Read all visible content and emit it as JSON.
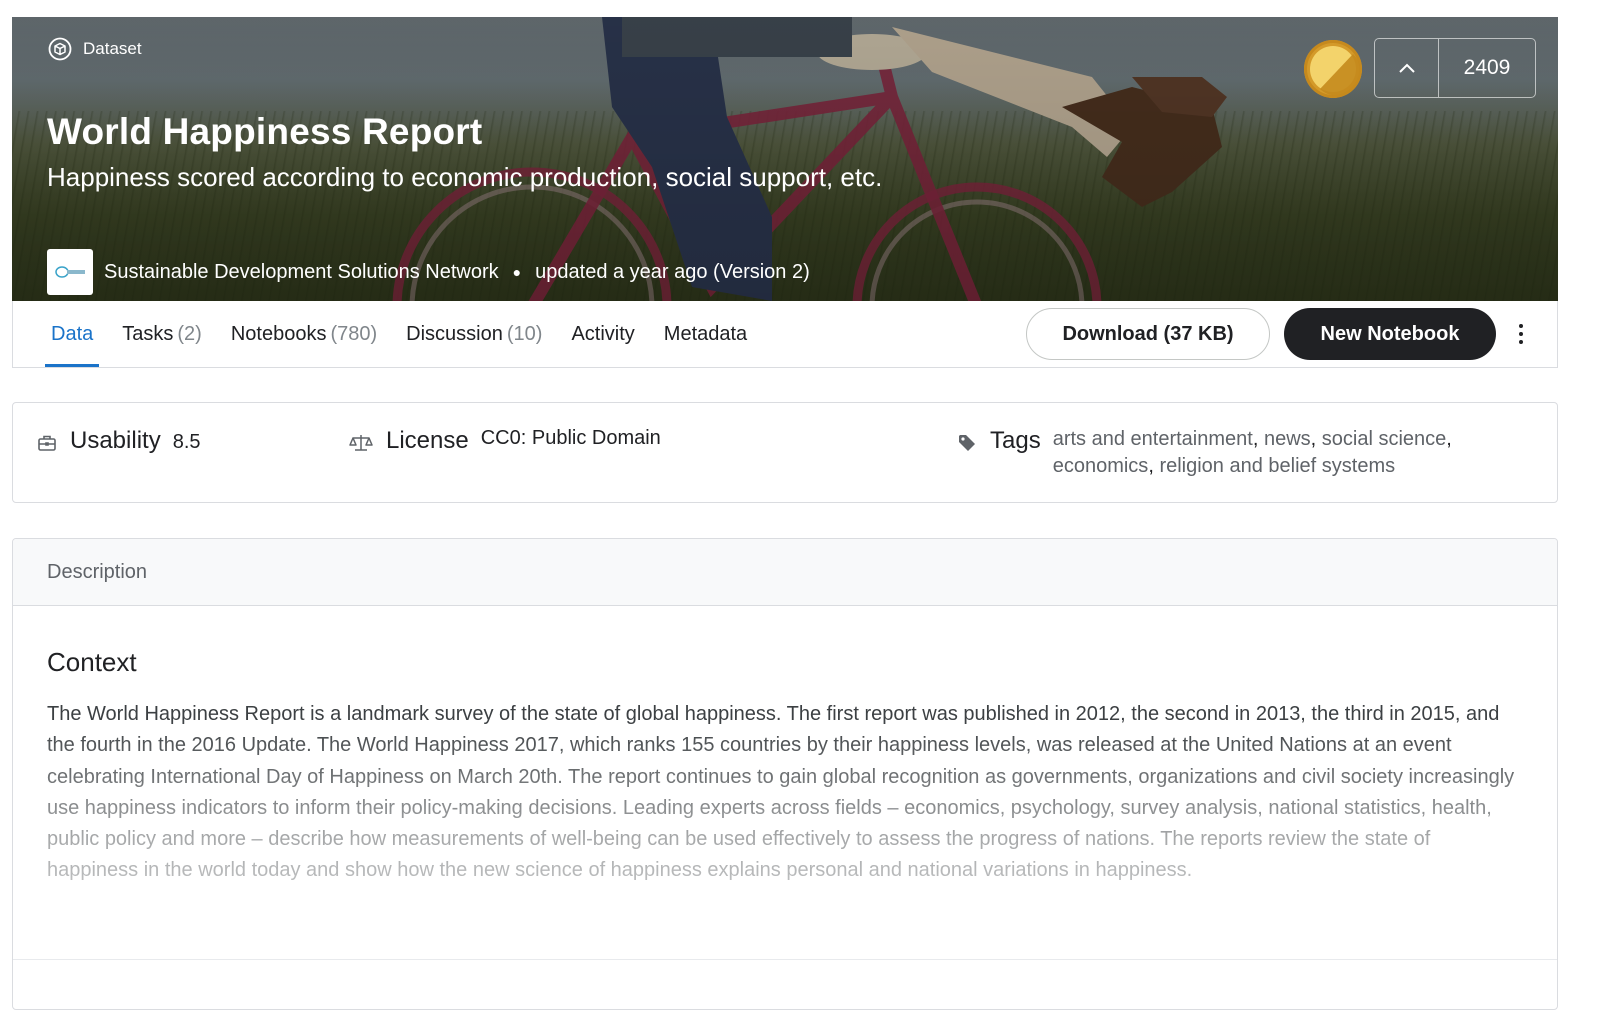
{
  "hero": {
    "type_label": "Dataset",
    "title": "World Happiness Report",
    "subtitle": "Happiness scored according to economic production, social support, etc.",
    "owner": "Sustainable Development Solutions Network",
    "updated": "updated a year ago (Version 2)",
    "upvotes": "2409",
    "medal_color": "#d49a2a"
  },
  "tabs": [
    {
      "label": "Data",
      "count": ""
    },
    {
      "label": "Tasks",
      "count": "(2)"
    },
    {
      "label": "Notebooks",
      "count": "(780)"
    },
    {
      "label": "Discussion",
      "count": "(10)"
    },
    {
      "label": "Activity",
      "count": ""
    },
    {
      "label": "Metadata",
      "count": ""
    }
  ],
  "actions": {
    "download": "Download (37 KB)",
    "new_notebook": "New Notebook"
  },
  "meta": {
    "usability_label": "Usability",
    "usability_value": "8.5",
    "license_label": "License",
    "license_value": "CC0: Public Domain",
    "tags_label": "Tags",
    "tags": [
      "arts and entertainment",
      "news",
      "social science",
      "economics",
      "religion and belief systems"
    ]
  },
  "description": {
    "header": "Description",
    "heading": "Context",
    "body": "The World Happiness Report is a landmark survey of the state of global happiness. The first report was published in 2012, the second in 2013, the third in 2015, and the fourth in the 2016 Update. The World Happiness 2017, which ranks 155 countries by their happiness levels, was released at the United Nations at an event celebrating International Day of Happiness on March 20th. The report continues to gain global recognition as governments, organizations and civil society increasingly use happiness indicators to inform their policy-making decisions. Leading experts across fields – economics, psychology, survey analysis, national statistics, health, public policy and more – describe how measurements of well-being can be used effectively to assess the progress of nations. The reports review the state of happiness in the world today and show how the new science of happiness explains personal and national variations in happiness."
  },
  "colors": {
    "accent": "#1a73c9",
    "primary_button": "#202124"
  }
}
